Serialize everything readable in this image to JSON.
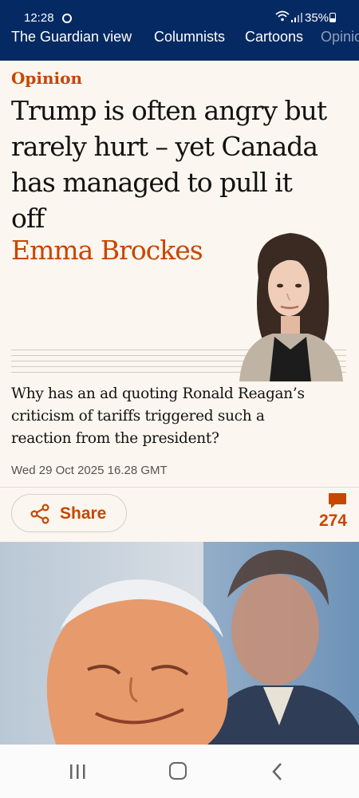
{
  "status_bar": {
    "time": "12:28",
    "battery": "35%"
  },
  "nav": {
    "items": [
      "The Guardian view",
      "Columnists",
      "Cartoons",
      "Opinion"
    ],
    "accent": "#052962"
  },
  "article": {
    "kicker": "Opinion",
    "headline_lines": [
      "Trump is often angry but",
      "rarely hurt – yet Canada",
      "has managed to pull it",
      "off"
    ],
    "byline": "Emma Brockes",
    "standfirst_lines": [
      "Why has an ad quoting Ronald Reagan’s",
      "criticism of tariffs triggered such a",
      "reaction from the president?"
    ],
    "date": "Wed 29 Oct 2025 16.28 GMT",
    "accent": "#c74600"
  },
  "actions": {
    "share_label": "Share",
    "comment_count": "274",
    "share_icon": "share-icon",
    "comment_icon": "comment-icon"
  },
  "system_nav": {
    "icons": [
      "recent-apps-icon",
      "home-icon",
      "back-icon"
    ]
  }
}
